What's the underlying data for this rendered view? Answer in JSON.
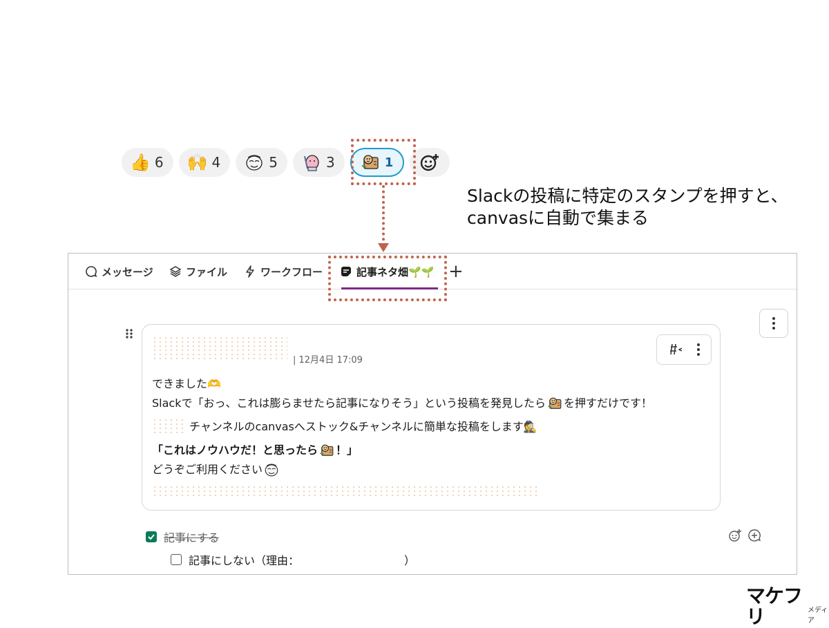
{
  "reactions": [
    {
      "icon": "thumbs-up-icon",
      "emoji": "👍",
      "count": "6"
    },
    {
      "icon": "raised-hands-icon",
      "emoji": "🙌",
      "count": "4"
    },
    {
      "icon": "mascot-sticker-icon",
      "count": "5"
    },
    {
      "icon": "pink-mascot-sticker-icon",
      "count": "3"
    },
    {
      "icon": "notebook-mascot-sticker-icon",
      "count": "1",
      "active": true
    }
  ],
  "caption": {
    "line1": "Slackの投稿に特定のスタンプを押すと、",
    "line2": "canvasに自動で集まる"
  },
  "tabs": {
    "messages": "メッセージ",
    "files": "ファイル",
    "workflow": "ワークフロー",
    "canvas": "記事ネタ畑🌱🌱"
  },
  "message": {
    "timestamp": "| 12月4日 17:09",
    "line1": "できました🫶",
    "line2a": "Slackで「おっ、これは膨らませたら記事になりそう」という投稿を発見したら",
    "line2b": "を押すだけです！",
    "line3": "チャンネルのcanvasへストック&チャンネルに簡単な投稿をします🕵️",
    "line4a": "「これはノウハウだ！と思ったら",
    "line4b": "！」",
    "line5": "どうぞご利用ください"
  },
  "checklist": {
    "item1": "記事にする",
    "item2": "記事にしない（理由：　　　　　　　　　　）"
  },
  "logo": {
    "main": "マケフリ",
    "sub": "メディア"
  },
  "colors": {
    "highlight": "#c2624d",
    "tab_underline": "#7b2a8c",
    "check": "#0b7a5a",
    "active_reaction": "#1d9bd1"
  }
}
